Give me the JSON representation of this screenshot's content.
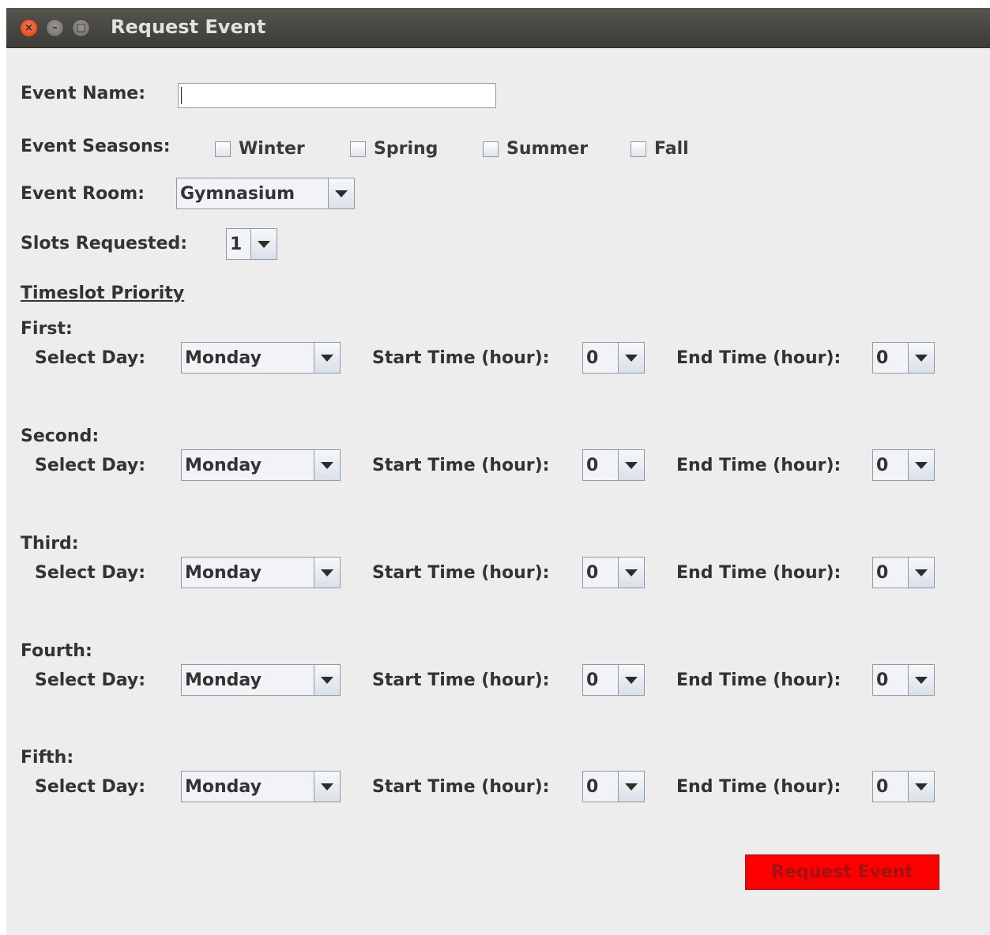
{
  "window": {
    "title": "Request Event"
  },
  "form": {
    "event_name_label": "Event Name:",
    "event_name_value": "",
    "seasons_label": "Event Seasons:",
    "seasons": [
      {
        "label": "Winter",
        "checked": false
      },
      {
        "label": "Spring",
        "checked": false
      },
      {
        "label": "Summer",
        "checked": false
      },
      {
        "label": "Fall",
        "checked": false
      }
    ],
    "room_label": "Event Room:",
    "room_value": "Gymnasium",
    "slots_label": "Slots Requested:",
    "slots_value": "1",
    "priority_heading": "Timeslot Priority",
    "slots": [
      {
        "heading": "First:",
        "day_label": "Select Day:",
        "day": "Monday",
        "start_label": "Start Time (hour):",
        "start": "0",
        "end_label": "End Time (hour):",
        "end": "0"
      },
      {
        "heading": "Second:",
        "day_label": "Select Day:",
        "day": "Monday",
        "start_label": "Start Time (hour):",
        "start": "0",
        "end_label": "End Time (hour):",
        "end": "0"
      },
      {
        "heading": "Third:",
        "day_label": "Select Day:",
        "day": "Monday",
        "start_label": "Start Time (hour):",
        "start": "0",
        "end_label": "End Time (hour):",
        "end": "0"
      },
      {
        "heading": "Fourth:",
        "day_label": "Select Day:",
        "day": "Monday",
        "start_label": "Start Time (hour):",
        "start": "0",
        "end_label": "End Time (hour):",
        "end": "0"
      },
      {
        "heading": "Fifth:",
        "day_label": "Select Day:",
        "day": "Monday",
        "start_label": "Start Time (hour):",
        "start": "0",
        "end_label": "End Time (hour):",
        "end": "0"
      }
    ],
    "submit_label": "Request Event"
  },
  "colors": {
    "submit_background": "#ff0000",
    "submit_text": "#a31212",
    "titlebar": "#3d3b37"
  }
}
